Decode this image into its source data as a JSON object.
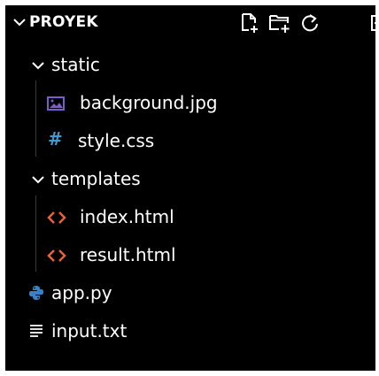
{
  "explorer": {
    "title": "PROYEK",
    "actions": [
      "new-file-icon",
      "new-folder-icon",
      "refresh-icon",
      "collapse-all-icon"
    ],
    "tree": [
      {
        "type": "folder",
        "label": "static",
        "expanded": true
      },
      {
        "type": "file",
        "label": "background.jpg",
        "icon": "image-file-icon"
      },
      {
        "type": "file",
        "label": "style.css",
        "icon": "css-file-icon"
      },
      {
        "type": "folder",
        "label": "templates",
        "expanded": true
      },
      {
        "type": "file",
        "label": "index.html",
        "icon": "html-file-icon"
      },
      {
        "type": "file",
        "label": "result.html",
        "icon": "html-file-icon"
      },
      {
        "type": "file",
        "label": "app.py",
        "icon": "python-file-icon"
      },
      {
        "type": "file",
        "label": "input.txt",
        "icon": "text-file-icon"
      }
    ]
  },
  "colors": {
    "background": "#000000",
    "text": "#ffffff",
    "html_icon": "#e8623a",
    "css_icon": "#3e9bd6",
    "python_icon": "#3b82c4",
    "image_icon": "#7b5cc8",
    "guide": "#3a3a3a"
  }
}
